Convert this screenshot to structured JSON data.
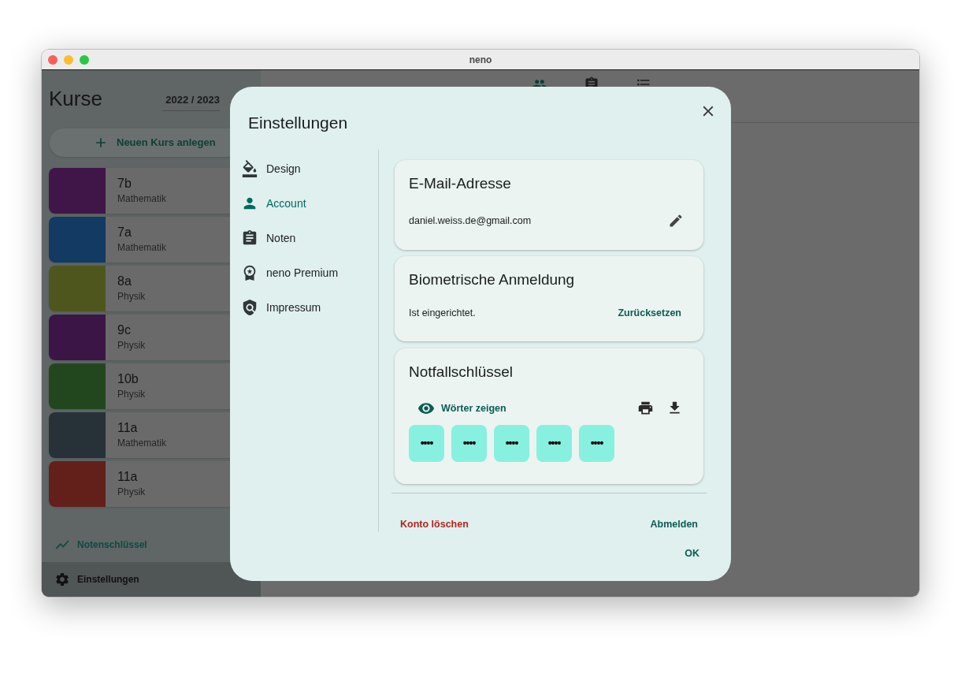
{
  "window": {
    "title": "neno"
  },
  "sidebar": {
    "title": "Kurse",
    "year": "2022 / 2023",
    "add_button": "Neuen Kurs anlegen",
    "courses": [
      {
        "name": "7b",
        "subject": "Mathematik",
        "color": "#3f1647"
      },
      {
        "name": "7a",
        "subject": "Mathematik",
        "color": "#123a62"
      },
      {
        "name": "8a",
        "subject": "Physik",
        "color": "#4e561e"
      },
      {
        "name": "9c",
        "subject": "Physik",
        "color": "#3c1547"
      },
      {
        "name": "10b",
        "subject": "Physik",
        "color": "#22471f"
      },
      {
        "name": "11a",
        "subject": "Mathematik",
        "color": "#263238"
      },
      {
        "name": "11a",
        "subject": "Physik",
        "color": "#631f1a"
      }
    ],
    "footer_items": [
      {
        "kind": "chart",
        "label": "Notenschlüssel",
        "selected": false
      },
      {
        "kind": "settings",
        "label": "Einstellungen",
        "selected": true
      }
    ]
  },
  "toolbar_tabs": [
    {
      "kind": "people",
      "selected": true
    },
    {
      "kind": "grades",
      "selected": false
    },
    {
      "kind": "list",
      "selected": false
    }
  ],
  "dialog": {
    "title": "Einstellungen",
    "nav": [
      {
        "kind": "design",
        "label": "Design",
        "selected": false
      },
      {
        "kind": "account",
        "label": "Account",
        "selected": true
      },
      {
        "kind": "grades",
        "label": "Noten",
        "selected": false
      },
      {
        "kind": "premium",
        "label": "neno Premium",
        "selected": false
      },
      {
        "kind": "imprint",
        "label": "Impressum",
        "selected": false
      }
    ],
    "email": {
      "title": "E-Mail-Adresse",
      "value": "daniel.weiss.de@gmail.com"
    },
    "biometric": {
      "title": "Biometrische Anmeldung",
      "status": "Ist eingerichtet.",
      "action": "Zurücksetzen"
    },
    "recovery": {
      "title": "Notfallschlüssel",
      "show_button": "Wörter zeigen",
      "words": [
        "••••",
        "••••",
        "••••",
        "••••",
        "••••"
      ]
    },
    "delete_button": "Konto löschen",
    "logout_button": "Abmelden",
    "ok_button": "OK"
  }
}
